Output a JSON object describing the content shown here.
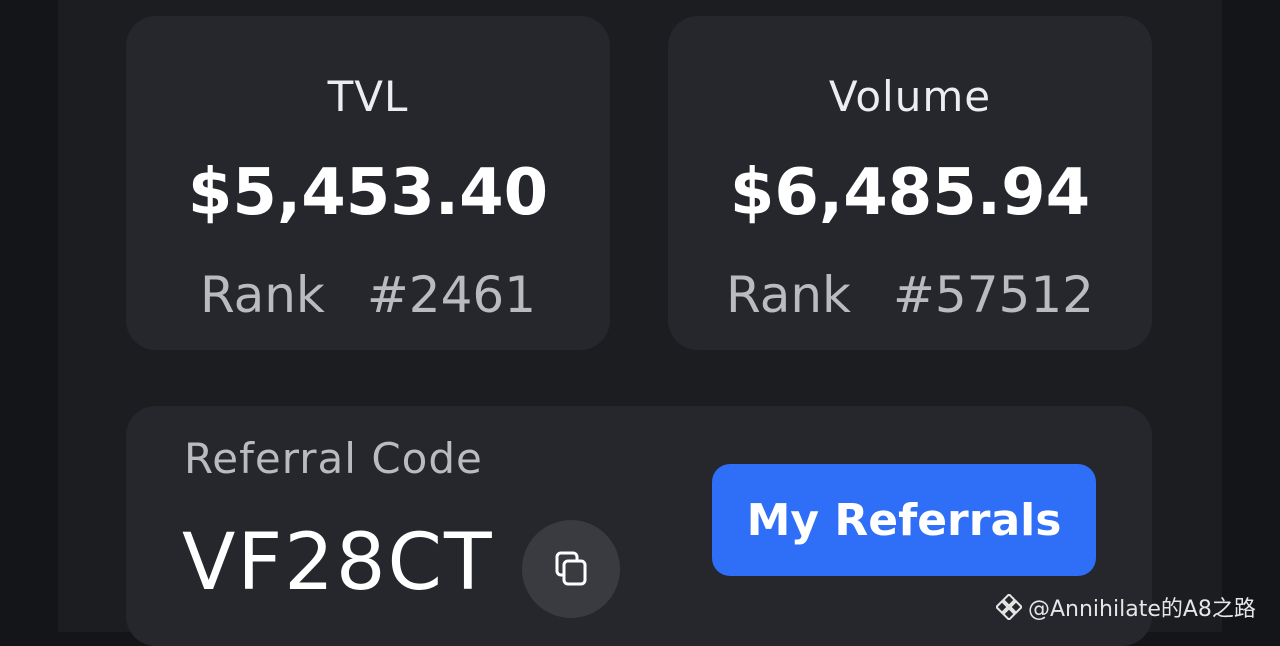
{
  "stats": [
    {
      "title": "TVL",
      "value": "$5,453.40",
      "rank_label": "Rank",
      "rank_value": "#2461"
    },
    {
      "title": "Volume",
      "value": "$6,485.94",
      "rank_label": "Rank",
      "rank_value": "#57512"
    }
  ],
  "referral": {
    "label": "Referral Code",
    "code": "VF28CT",
    "copy_icon": "copy-icon",
    "button_label": "My Referrals"
  },
  "colors": {
    "background": "#141519",
    "panel": "#1c1d21",
    "card": "#26272d",
    "accent": "#2f6ef6"
  },
  "watermark": {
    "text": "@Annihilate的A8之路",
    "icon": "binance-logo-icon"
  }
}
